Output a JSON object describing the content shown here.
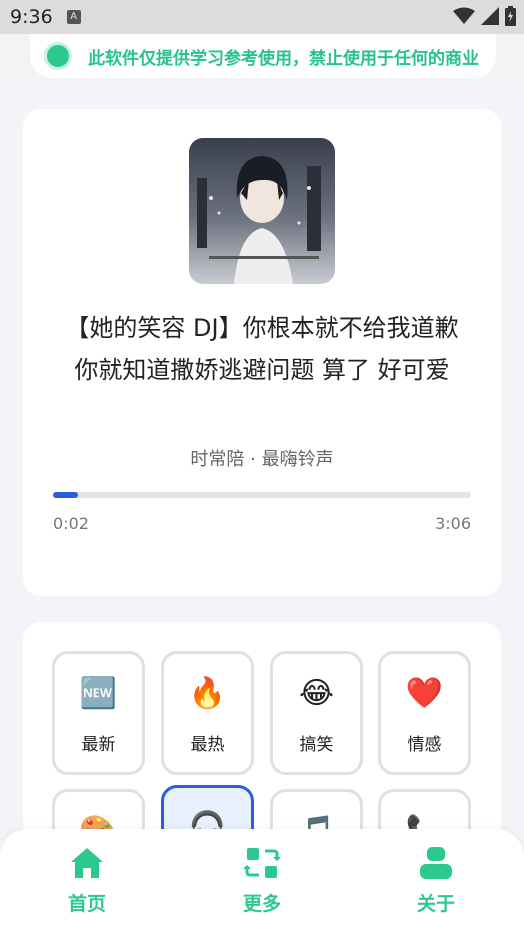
{
  "status_bar": {
    "time": "9:36",
    "notification_icon": "a-icon"
  },
  "notice": {
    "text": "此软件仅提供学习参考使用，禁止使用于任何的商业"
  },
  "player": {
    "cover_icon": "album-cover",
    "title": "【她的笑容 DJ】你根本就不给我道歉 你就知道撒娇逃避问题 算了 好可爱",
    "artist": "时常陪 · 最嗨铃声",
    "current_time": "0:02",
    "total_time": "3:06",
    "progress": 0.011
  },
  "categories": [
    {
      "label": "最新",
      "icon": "🆕"
    },
    {
      "label": "最热",
      "icon": "🔥"
    },
    {
      "label": "搞笑",
      "icon": "😂"
    },
    {
      "label": "情感",
      "icon": "❤️"
    },
    {
      "label": "",
      "icon": "🎨"
    },
    {
      "label": "",
      "icon": "🎧"
    },
    {
      "label": "",
      "icon": "🎵"
    },
    {
      "label": "",
      "icon": "📞"
    }
  ],
  "nav": {
    "home": "首页",
    "more": "更多",
    "about": "关于"
  },
  "colors": {
    "accent_green": "#2cc98f",
    "accent_blue": "#2a5de0"
  }
}
